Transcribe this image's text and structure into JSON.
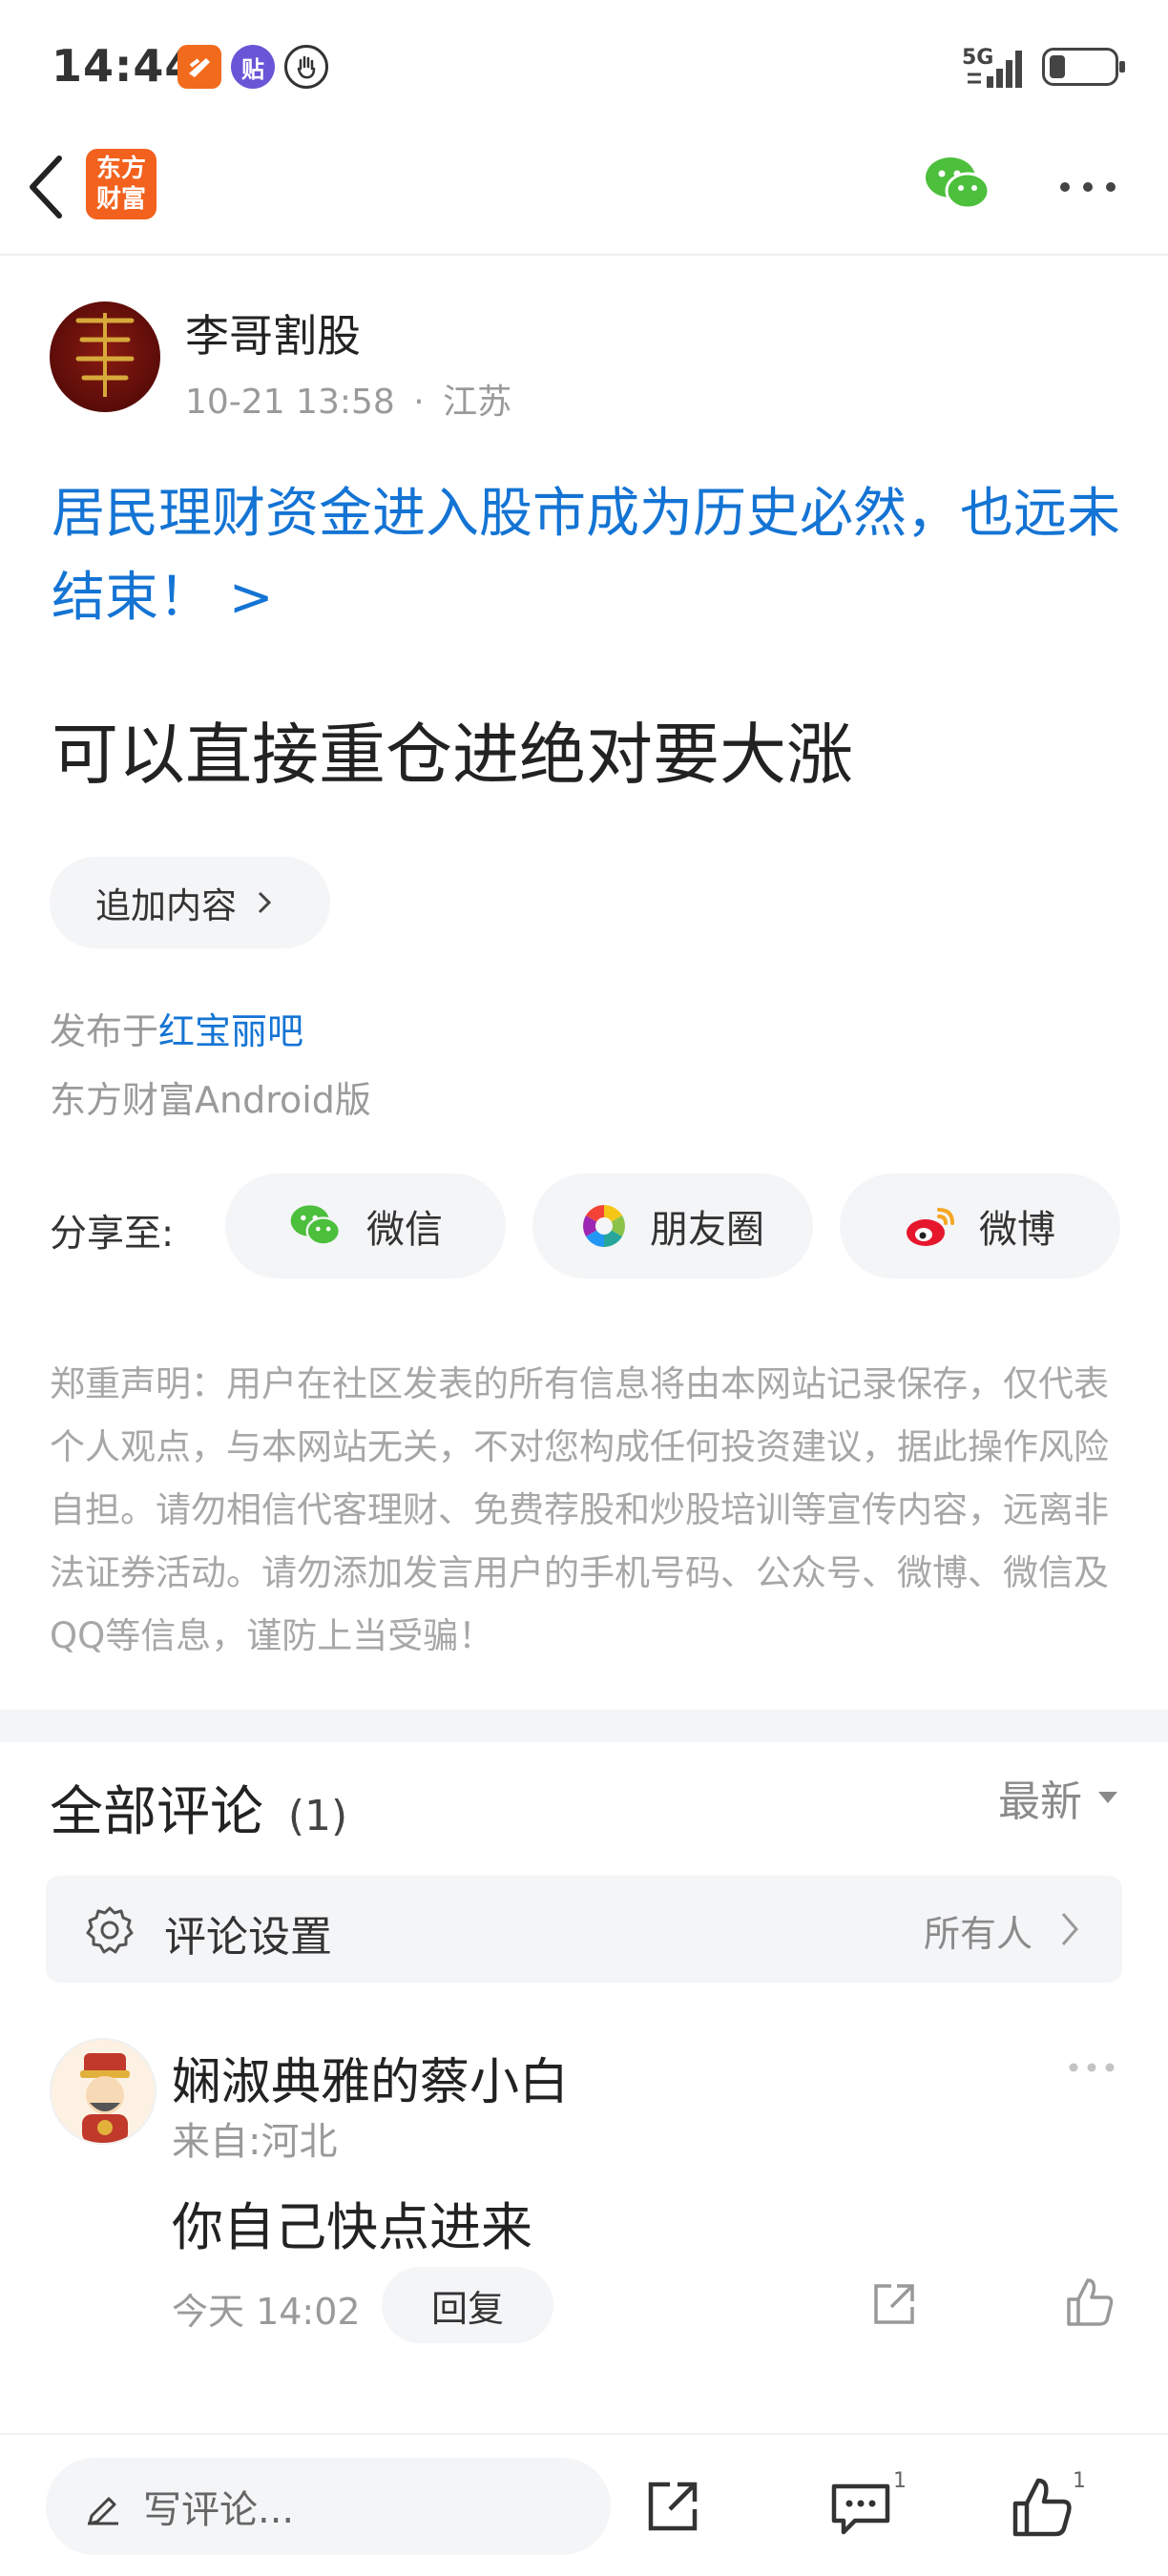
{
  "status_bar": {
    "time": "14:44",
    "network": "5G",
    "app_icon_2": "贴"
  },
  "nav": {
    "logo_line1": "东方",
    "logo_line2": "财富"
  },
  "post": {
    "author": "李哥割股",
    "date": "10-21 13:58",
    "separator": "·",
    "location": "江苏",
    "title_link": "居民理财资金进入股市成为历史必然，也远未结束！ >",
    "body": "可以直接重仓进绝对要大涨",
    "append_label": "追加内容",
    "published_prefix": "发布于",
    "bar_name": "红宝丽吧",
    "client": "东方财富Android版"
  },
  "share": {
    "label": "分享至:",
    "wechat": "微信",
    "moments": "朋友圈",
    "weibo": "微博"
  },
  "disclaimer": "郑重声明：用户在社区发表的所有信息将由本网站记录保存，仅代表个人观点，与本网站无关，不对您构成任何投资建议，据此操作风险自担。请勿相信代客理财、免费荐股和炒股培训等宣传内容，远离非法证券活动。请勿添加发言用户的手机号码、公众号、微博、微信及QQ等信息，谨防上当受骗！",
  "comments": {
    "title": "全部评论",
    "count": "(1)",
    "sort": "最新",
    "settings_label": "评论设置",
    "settings_value": "所有人",
    "items": [
      {
        "name": "娴淑典雅的蔡小白",
        "from": "来自:河北",
        "text": "你自己快点进来",
        "time": "今天 14:02",
        "reply": "回复"
      }
    ]
  },
  "bottom": {
    "write_placeholder": "写评论...",
    "comment_count": "1",
    "like_count": "1"
  },
  "colors": {
    "brand": "#f2611d",
    "link": "#1474d4",
    "wechat": "#4cbf3c",
    "weibo": "#e6162d"
  }
}
